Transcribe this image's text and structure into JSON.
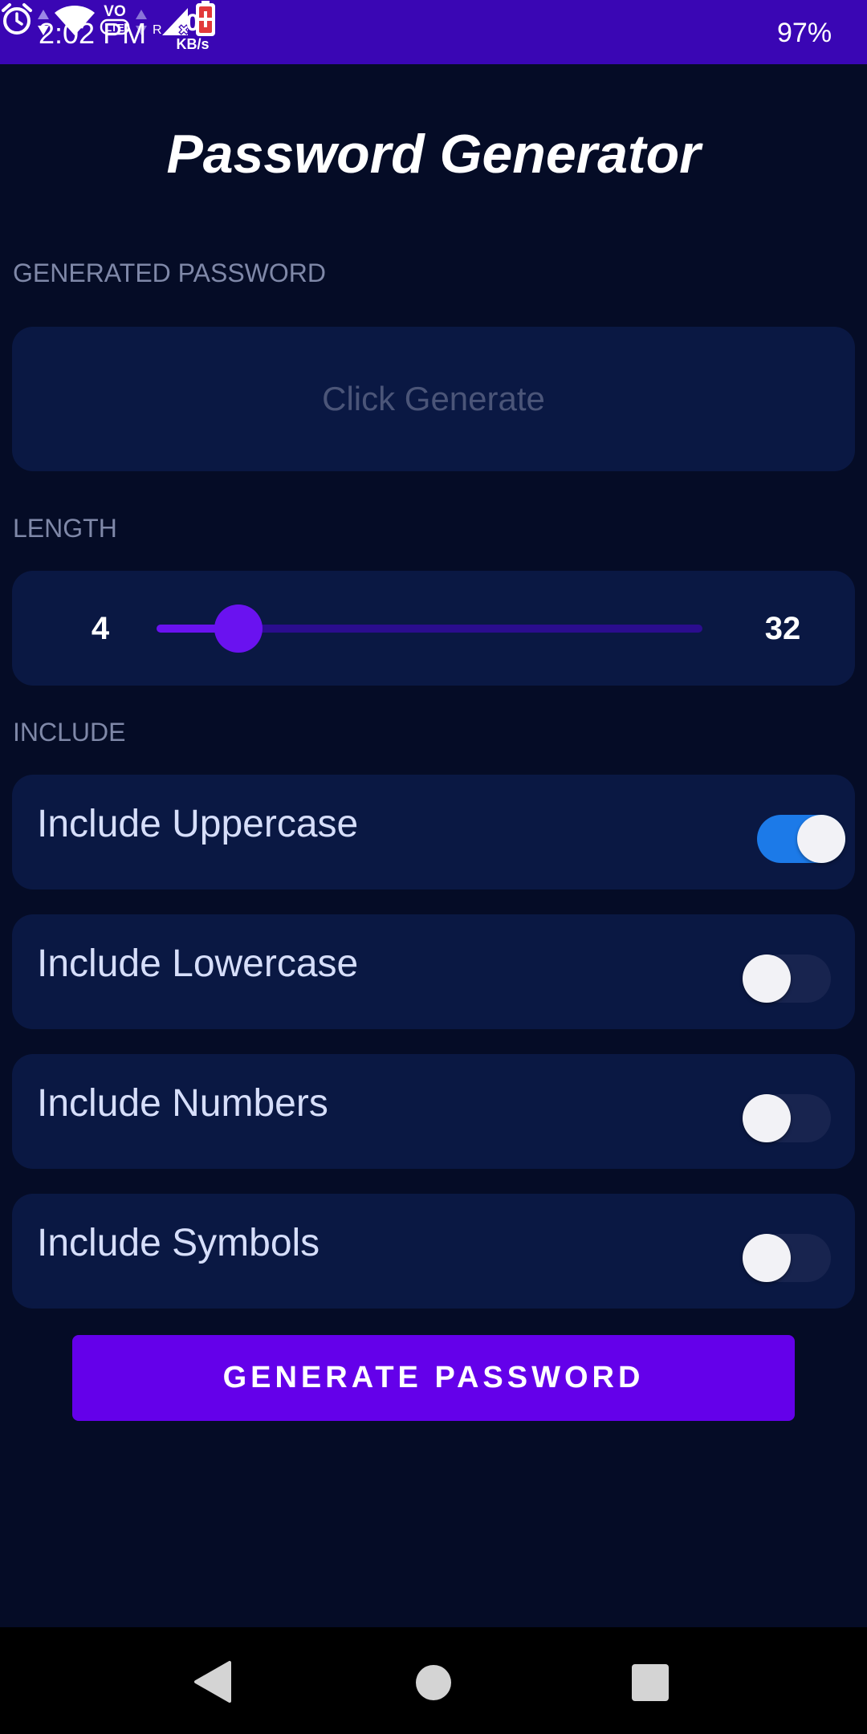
{
  "status_bar": {
    "time": "2:02 PM",
    "net_speed_value": "0",
    "net_speed_unit": "KB/s",
    "battery_percent": "97%",
    "icons": [
      "alarm-icon",
      "data-arrows-icon",
      "wifi-icon",
      "volte-icon",
      "signal-icon",
      "battery-charging-icon"
    ]
  },
  "header": {
    "title": "Password Generator"
  },
  "generated_password": {
    "label": "GENERATED PASSWORD",
    "placeholder": "Click Generate"
  },
  "length": {
    "label": "LENGTH",
    "min_label": "4",
    "max_label": "32",
    "slider_fraction": 0.15
  },
  "include": {
    "label": "INCLUDE",
    "options": [
      {
        "label": "Include Uppercase",
        "enabled": true
      },
      {
        "label": "Include Lowercase",
        "enabled": false
      },
      {
        "label": "Include Numbers",
        "enabled": false
      },
      {
        "label": "Include Symbols",
        "enabled": false
      }
    ]
  },
  "actions": {
    "generate_label": "GENERATE PASSWORD"
  },
  "colors": {
    "background": "#050c26",
    "status_bar": "#3a06b4",
    "card": "#0a1843",
    "accent": "#6400ea",
    "switch_on": "#1c7ae8"
  },
  "nav_bar": {
    "icons": [
      "back-icon",
      "home-icon",
      "recents-icon"
    ]
  }
}
